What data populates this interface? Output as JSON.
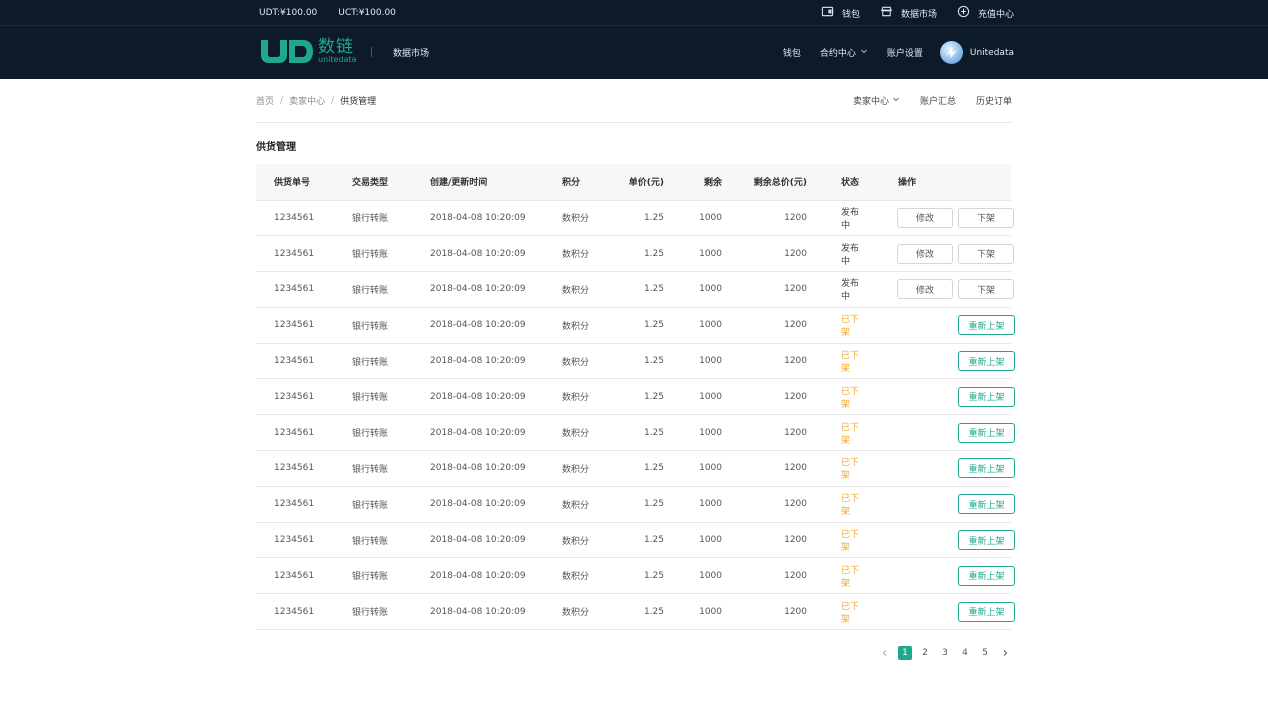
{
  "topbar": {
    "udt_balance": "UDT:¥100.00",
    "uct_balance": "UCT:¥100.00",
    "links": [
      {
        "label": "钱包",
        "icon": "wallet-icon"
      },
      {
        "label": "数据市场",
        "icon": "store-icon"
      },
      {
        "label": "充值中心",
        "icon": "recharge-icon"
      }
    ]
  },
  "nav": {
    "brand_cn": "数链",
    "brand_en": "unitedata",
    "market": "数据市场",
    "wallet": "钱包",
    "contract_center": "合约中心",
    "account_settings": "账户设置",
    "username": "Unitedata"
  },
  "breadcrumb": {
    "home": "首页",
    "seller_center": "卖家中心",
    "current": "供货管理"
  },
  "subnav": {
    "seller_center": "卖家中心",
    "account_summary": "账户汇总",
    "history_orders": "历史订单"
  },
  "page_title": "供货管理",
  "table": {
    "headers": [
      "供货单号",
      "交易类型",
      "创建/更新时间",
      "积分",
      "单价(元)",
      "剩余",
      "剩余总价(元)",
      "状态",
      "操作"
    ],
    "edit_label": "修改",
    "off_label": "下架",
    "relist_label": "重新上架",
    "rows": [
      {
        "id": "1234561",
        "type": "银行转账",
        "time": "2018-04-08 10:20:09",
        "points": "数积分",
        "price": "1.25",
        "remaining": "1000",
        "total": "1200",
        "status": "发布中",
        "active": true
      },
      {
        "id": "1234561",
        "type": "银行转账",
        "time": "2018-04-08 10:20:09",
        "points": "数积分",
        "price": "1.25",
        "remaining": "1000",
        "total": "1200",
        "status": "发布中",
        "active": true
      },
      {
        "id": "1234561",
        "type": "银行转账",
        "time": "2018-04-08 10:20:09",
        "points": "数积分",
        "price": "1.25",
        "remaining": "1000",
        "total": "1200",
        "status": "发布中",
        "active": true
      },
      {
        "id": "1234561",
        "type": "银行转账",
        "time": "2018-04-08 10:20:09",
        "points": "数积分",
        "price": "1.25",
        "remaining": "1000",
        "total": "1200",
        "status": "已下架",
        "active": false
      },
      {
        "id": "1234561",
        "type": "银行转账",
        "time": "2018-04-08 10:20:09",
        "points": "数积分",
        "price": "1.25",
        "remaining": "1000",
        "total": "1200",
        "status": "已下架",
        "active": false
      },
      {
        "id": "1234561",
        "type": "银行转账",
        "time": "2018-04-08 10:20:09",
        "points": "数积分",
        "price": "1.25",
        "remaining": "1000",
        "total": "1200",
        "status": "已下架",
        "active": false
      },
      {
        "id": "1234561",
        "type": "银行转账",
        "time": "2018-04-08 10:20:09",
        "points": "数积分",
        "price": "1.25",
        "remaining": "1000",
        "total": "1200",
        "status": "已下架",
        "active": false
      },
      {
        "id": "1234561",
        "type": "银行转账",
        "time": "2018-04-08 10:20:09",
        "points": "数积分",
        "price": "1.25",
        "remaining": "1000",
        "total": "1200",
        "status": "已下架",
        "active": false
      },
      {
        "id": "1234561",
        "type": "银行转账",
        "time": "2018-04-08 10:20:09",
        "points": "数积分",
        "price": "1.25",
        "remaining": "1000",
        "total": "1200",
        "status": "已下架",
        "active": false
      },
      {
        "id": "1234561",
        "type": "银行转账",
        "time": "2018-04-08 10:20:09",
        "points": "数积分",
        "price": "1.25",
        "remaining": "1000",
        "total": "1200",
        "status": "已下架",
        "active": false
      },
      {
        "id": "1234561",
        "type": "银行转账",
        "time": "2018-04-08 10:20:09",
        "points": "数积分",
        "price": "1.25",
        "remaining": "1000",
        "total": "1200",
        "status": "已下架",
        "active": false
      },
      {
        "id": "1234561",
        "type": "银行转账",
        "time": "2018-04-08 10:20:09",
        "points": "数积分",
        "price": "1.25",
        "remaining": "1000",
        "total": "1200",
        "status": "已下架",
        "active": false
      }
    ]
  },
  "pagination": {
    "pages": [
      "1",
      "2",
      "3",
      "4",
      "5"
    ],
    "current": "1",
    "prev_icon": "chevron-left-icon",
    "next_icon": "chevron-right-icon"
  },
  "colors": {
    "header_bg": "#0d1a2a",
    "accent": "#1fa88f",
    "status_off": "#f0a92b"
  }
}
